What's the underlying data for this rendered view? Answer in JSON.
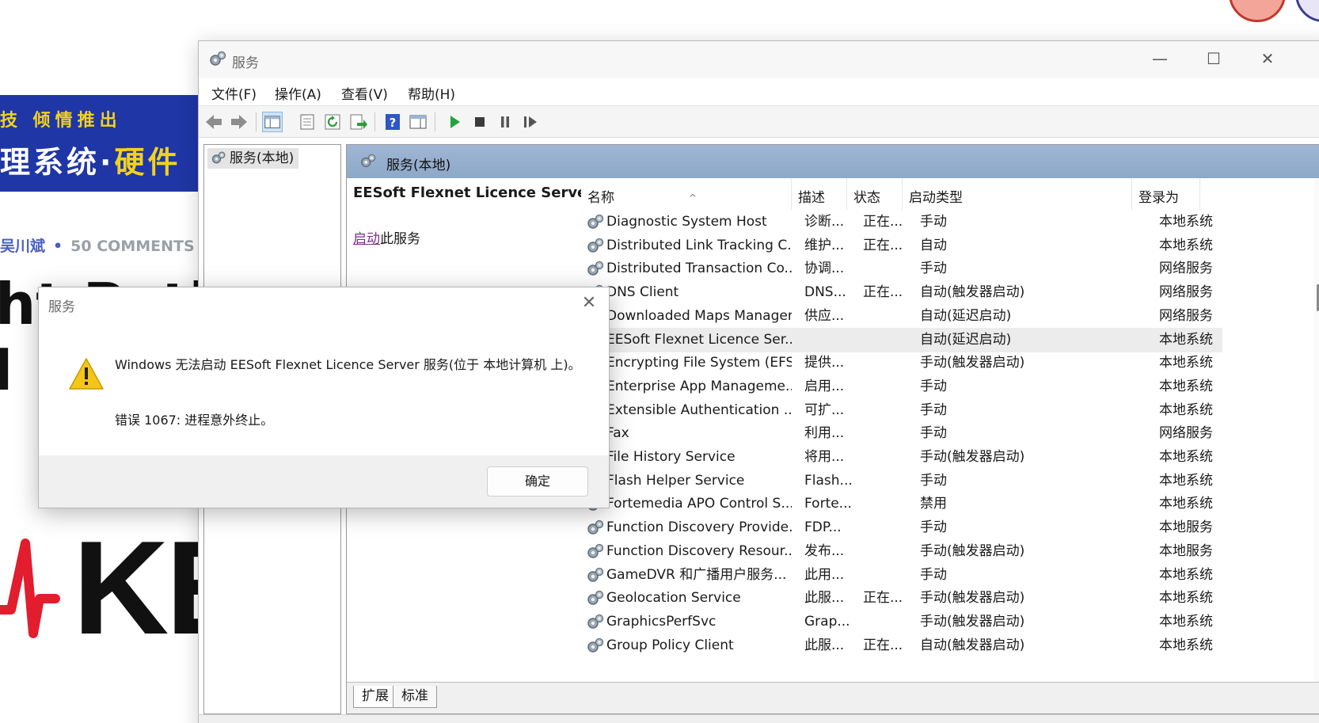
{
  "background": {
    "banner_line1": "技 倾情推出",
    "banner_line2_white": "理系统·",
    "banner_line2_yellow": "硬件",
    "author": "吴川斌",
    "comments": "50 COMMENTS",
    "headline_1": "ht Path V",
    "headline_2": "I",
    "logo_text": "KE",
    "accent_blue": "#1f36a6",
    "accent_yellow": "#f3d21a",
    "logo_red": "#e11d2e"
  },
  "window": {
    "title": "服务",
    "controls": {
      "minimize": "—",
      "maximize": "☐",
      "close": "✕"
    },
    "menu": [
      "文件(F)",
      "操作(A)",
      "查看(V)",
      "帮助(H)"
    ],
    "toolbar_icons": [
      "back-icon",
      "forward-icon",
      "show-hide-console-tree-icon",
      "properties-icon",
      "refresh-icon",
      "export-list-icon",
      "help-icon",
      "action-pane-icon",
      "start-service-icon",
      "stop-service-icon",
      "pause-service-icon",
      "restart-service-icon"
    ],
    "tree": {
      "root": "服务(本地)"
    },
    "pane_header": "服务(本地)",
    "selected_service_title": "EESoft Flexnet Licence Server",
    "start_link": "启动",
    "start_suffix": "此服务",
    "columns": {
      "name": "名称",
      "desc": "描述",
      "status": "状态",
      "startup": "启动类型",
      "logon": "登录为"
    },
    "services": [
      {
        "name": "Diagnostic System Host",
        "desc": "诊断...",
        "status": "正在...",
        "startup": "手动",
        "logon": "本地系统"
      },
      {
        "name": "Distributed Link Tracking C...",
        "desc": "维护...",
        "status": "正在...",
        "startup": "自动",
        "logon": "本地系统"
      },
      {
        "name": "Distributed Transaction Co...",
        "desc": "协调...",
        "status": "",
        "startup": "手动",
        "logon": "网络服务"
      },
      {
        "name": "DNS Client",
        "desc": "DNS...",
        "status": "正在...",
        "startup": "自动(触发器启动)",
        "logon": "网络服务"
      },
      {
        "name": "Downloaded Maps Manager",
        "desc": "供应...",
        "status": "",
        "startup": "自动(延迟启动)",
        "logon": "网络服务"
      },
      {
        "name": "EESoft Flexnet Licence Ser...",
        "desc": "",
        "status": "",
        "startup": "自动(延迟启动)",
        "logon": "本地系统"
      },
      {
        "name": "Encrypting File System (EFS)",
        "desc": "提供...",
        "status": "",
        "startup": "手动(触发器启动)",
        "logon": "本地系统"
      },
      {
        "name": "Enterprise App Manageme...",
        "desc": "启用...",
        "status": "",
        "startup": "手动",
        "logon": "本地系统"
      },
      {
        "name": "Extensible Authentication ...",
        "desc": "可扩...",
        "status": "",
        "startup": "手动",
        "logon": "本地系统"
      },
      {
        "name": "Fax",
        "desc": "利用...",
        "status": "",
        "startup": "手动",
        "logon": "网络服务"
      },
      {
        "name": "File History Service",
        "desc": "将用...",
        "status": "",
        "startup": "手动(触发器启动)",
        "logon": "本地系统"
      },
      {
        "name": "Flash Helper Service",
        "desc": "Flash...",
        "status": "",
        "startup": "手动",
        "logon": "本地系统"
      },
      {
        "name": "Fortemedia APO Control S...",
        "desc": "Forte...",
        "status": "",
        "startup": "禁用",
        "logon": "本地系统"
      },
      {
        "name": "Function Discovery Provide...",
        "desc": "FDP...",
        "status": "",
        "startup": "手动",
        "logon": "本地服务"
      },
      {
        "name": "Function Discovery Resour...",
        "desc": "发布...",
        "status": "",
        "startup": "手动(触发器启动)",
        "logon": "本地服务"
      },
      {
        "name": "GameDVR 和广播用户服务...",
        "desc": "此用...",
        "status": "",
        "startup": "手动",
        "logon": "本地系统"
      },
      {
        "name": "Geolocation Service",
        "desc": "此服...",
        "status": "正在...",
        "startup": "手动(触发器启动)",
        "logon": "本地系统"
      },
      {
        "name": "GraphicsPerfSvc",
        "desc": "Grap...",
        "status": "",
        "startup": "手动(触发器启动)",
        "logon": "本地系统"
      },
      {
        "name": "Group Policy Client",
        "desc": "此服...",
        "status": "正在...",
        "startup": "自动(触发器启动)",
        "logon": "本地系统"
      }
    ],
    "tabs": [
      "扩展",
      "标准"
    ]
  },
  "dialog": {
    "title": "服务",
    "close": "✕",
    "message": "Windows 无法启动 EESoft Flexnet Licence Server 服务(位于 本地计算机 上)。",
    "error": "错误 1067: 进程意外终止。",
    "ok": "确定"
  }
}
